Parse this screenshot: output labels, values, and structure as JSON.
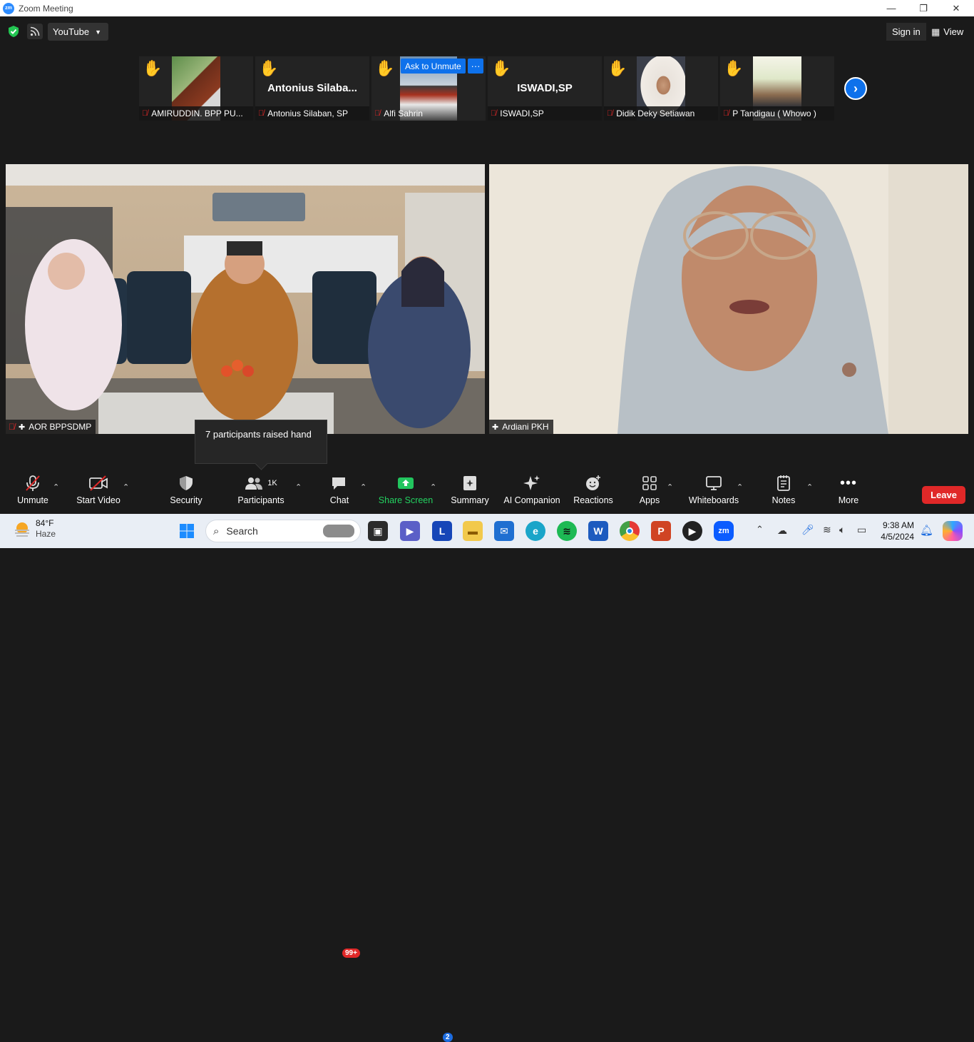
{
  "window": {
    "title": "Zoom Meeting",
    "app_logo": "zm"
  },
  "topbar": {
    "stream_target": "YouTube",
    "signin_label": "Sign in",
    "view_label": "View"
  },
  "thumbnails": [
    {
      "name": "AMIRUDDIN. BPP PU...",
      "display_name": "",
      "hand_raised": true,
      "muted": true
    },
    {
      "name": "Antonius Silaban, SP",
      "display_name": "Antonius Silaba...",
      "hand_raised": true,
      "muted": true
    },
    {
      "name": "Alfi Sahrin",
      "display_name": "",
      "hand_raised": true,
      "muted": true
    },
    {
      "name": "ISWADI,SP",
      "display_name": "ISWADI,SP",
      "hand_raised": true,
      "muted": true
    },
    {
      "name": "Didik Deky Setiawan",
      "display_name": "",
      "hand_raised": true,
      "muted": true
    },
    {
      "name": "P Tandigau ( Whowo )",
      "display_name": "",
      "hand_raised": true,
      "muted": true
    }
  ],
  "ask_unmute": {
    "label": "Ask to Unmute",
    "more": "···"
  },
  "videos": [
    {
      "name": "AOR BPPSDMP"
    },
    {
      "name": "Ardiani PKH"
    }
  ],
  "tooltip": {
    "text": "7 participants raised hand"
  },
  "toolbar": {
    "unmute": "Unmute",
    "start_video": "Start Video",
    "security": "Security",
    "participants": "Participants",
    "participants_count": "1K",
    "chat": "Chat",
    "chat_badge": "99+",
    "share_screen": "Share Screen",
    "summary": "Summary",
    "ai_companion": "AI Companion",
    "reactions": "Reactions",
    "apps": "Apps",
    "whiteboards": "Whiteboards",
    "notes": "Notes",
    "more": "More",
    "leave": "Leave"
  },
  "taskbar": {
    "weather_temp": "84°F",
    "weather_desc": "Haze",
    "search_placeholder": "Search",
    "time": "9:38 AM",
    "date": "4/5/2024",
    "notif_badge": "2"
  },
  "colors": {
    "accent": "#0e71eb",
    "leave": "#e02828",
    "share": "#22c55e",
    "hand": "#f6b13b"
  }
}
